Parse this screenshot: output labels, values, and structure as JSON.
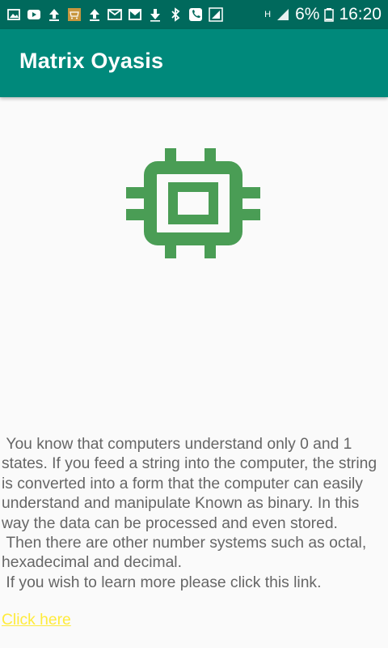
{
  "status_bar": {
    "icons_left": [
      "image-icon",
      "youtube-icon",
      "upload-icon",
      "shop-icon",
      "upload-icon",
      "mail-icon",
      "gmail-icon",
      "download-icon",
      "bluetooth-icon",
      "phone-icon",
      "signal-box-icon"
    ],
    "network": "H",
    "battery": "6%",
    "time": "16:20"
  },
  "app_bar": {
    "title": "Matrix Oyasis",
    "color": "#00897b",
    "status_color": "#00695c"
  },
  "main": {
    "icon": "chip-icon",
    "icon_color": "#4a9d55",
    "paragraph": " You know that computers understand only 0 and 1 states. If you feed a string into the computer, the string is converted into a form that the computer can easily understand and manipulate Known as binary. In this way the data can be processed and even stored.\n Then there are other number systems such as octal, hexadecimal and decimal.\n If you wish to learn more please click this link.",
    "link_text": "Click here",
    "link_color": "#ffeb3b"
  }
}
